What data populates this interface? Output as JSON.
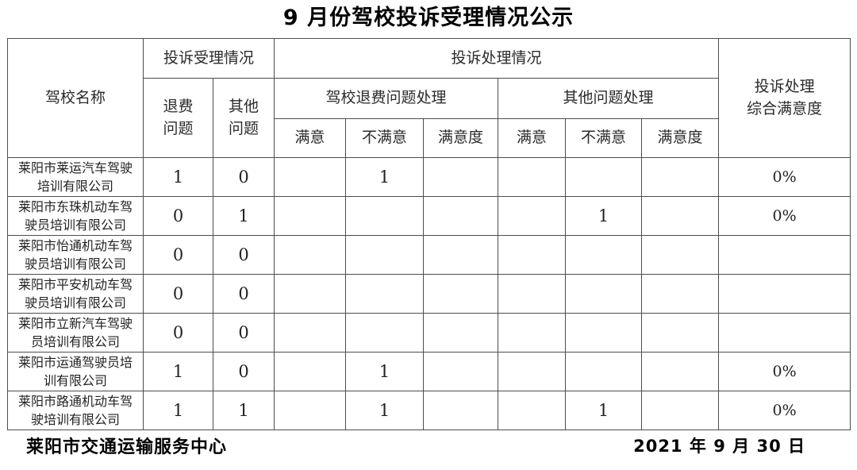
{
  "document": {
    "title": "9 月份驾校投诉受理情况公示"
  },
  "table": {
    "headers": {
      "name": "驾校名称",
      "accept_group": "投诉受理情况",
      "accept_refund_l1": "退费",
      "accept_refund_l2": "问题",
      "accept_other_l1": "其他",
      "accept_other_l2": "问题",
      "handle_group": "投诉处理情况",
      "handle_refund_group": "驾校退费问题处理",
      "handle_other_group": "其他问题处理",
      "satisfied": "满意",
      "unsatisfied": "不满意",
      "satisfaction_rate": "满意度",
      "overall_l1": "投诉处理",
      "overall_l2": "综合满意度"
    },
    "rows": [
      {
        "name_l1": "莱阳市莱运汽车驾驶",
        "name_l2": "培训有限公司",
        "accept_refund": "1",
        "accept_other": "0",
        "refund_satisfied": "",
        "refund_unsatisfied": "1",
        "refund_rate": "",
        "other_satisfied": "",
        "other_unsatisfied": "",
        "other_rate": "",
        "overall": "0%"
      },
      {
        "name_l1": "莱阳市东珠机动车驾",
        "name_l2": "驶员培训有限公司",
        "accept_refund": "0",
        "accept_other": "1",
        "refund_satisfied": "",
        "refund_unsatisfied": "",
        "refund_rate": "",
        "other_satisfied": "",
        "other_unsatisfied": "1",
        "other_rate": "",
        "overall": "0%"
      },
      {
        "name_l1": "莱阳市怡通机动车驾",
        "name_l2": "驶员培训有限公司",
        "accept_refund": "0",
        "accept_other": "0",
        "refund_satisfied": "",
        "refund_unsatisfied": "",
        "refund_rate": "",
        "other_satisfied": "",
        "other_unsatisfied": "",
        "other_rate": "",
        "overall": ""
      },
      {
        "name_l1": "莱阳市平安机动车驾",
        "name_l2": "驶员培训有限公司",
        "accept_refund": "0",
        "accept_other": "0",
        "refund_satisfied": "",
        "refund_unsatisfied": "",
        "refund_rate": "",
        "other_satisfied": "",
        "other_unsatisfied": "",
        "other_rate": "",
        "overall": ""
      },
      {
        "name_l1": "莱阳市立新汽车驾驶",
        "name_l2": "员培训有限公司",
        "accept_refund": "0",
        "accept_other": "0",
        "refund_satisfied": "",
        "refund_unsatisfied": "",
        "refund_rate": "",
        "other_satisfied": "",
        "other_unsatisfied": "",
        "other_rate": "",
        "overall": ""
      },
      {
        "name_l1": "莱阳市运通驾驶员培",
        "name_l2": "训有限公司",
        "accept_refund": "1",
        "accept_other": "0",
        "refund_satisfied": "",
        "refund_unsatisfied": "1",
        "refund_rate": "",
        "other_satisfied": "",
        "other_unsatisfied": "",
        "other_rate": "",
        "overall": "0%"
      },
      {
        "name_l1": "莱阳市路通机动车驾",
        "name_l2": "驶培训有限公司",
        "accept_refund": "1",
        "accept_other": "1",
        "refund_satisfied": "",
        "refund_unsatisfied": "1",
        "refund_rate": "",
        "other_satisfied": "",
        "other_unsatisfied": "1",
        "other_rate": "",
        "overall": "0%"
      }
    ]
  },
  "footer": {
    "issuer": "莱阳市交通运输服务中心",
    "date": "2021 年 9 月 30 日"
  }
}
